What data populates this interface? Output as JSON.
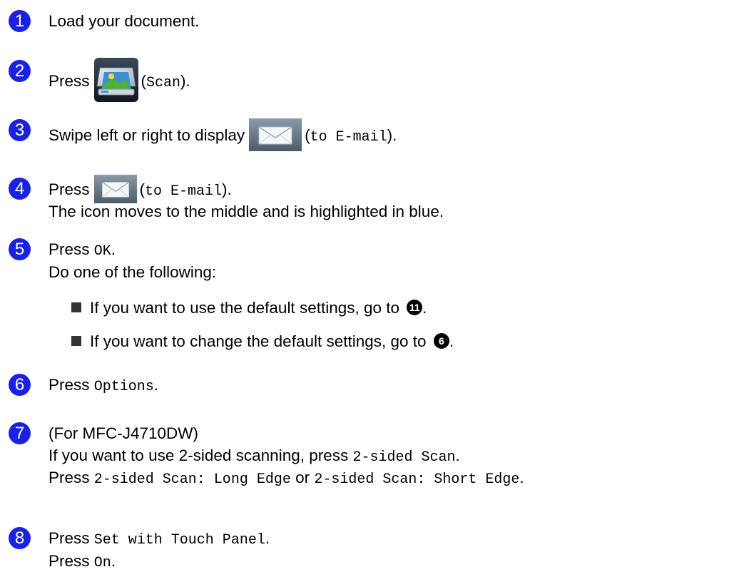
{
  "steps": [
    {
      "num": "1",
      "text": "Load your document."
    },
    {
      "num": "2",
      "pre": "Press",
      "paren_open": "(",
      "mono": "Scan",
      "paren_close": ").",
      "icon": "scan-icon"
    },
    {
      "num": "3",
      "pre": "Swipe left or right to display",
      "paren_open": "(",
      "mono": "to E-mail",
      "paren_close": ").",
      "icon": "mail-icon"
    },
    {
      "num": "4",
      "pre": "Press",
      "paren_open": "(",
      "mono": "to E-mail",
      "paren_close": ").",
      "icon": "mail-icon",
      "line2": "The icon moves to the middle and is highlighted in blue."
    },
    {
      "num": "5",
      "pre": "Press",
      "mono": "OK",
      "post": ".",
      "line2": "Do one of the following:",
      "bullets": [
        {
          "text": "If you want to use the default settings, go to",
          "ref": "11",
          "post": "."
        },
        {
          "text": "If you want to change the default settings, go to",
          "ref": "6",
          "post": "."
        }
      ]
    },
    {
      "num": "6",
      "pre": "Press",
      "mono": "Options",
      "post": "."
    },
    {
      "num": "7",
      "text": "(For MFC-J4710DW)",
      "line2_pre": "If you want to use 2-sided scanning, press",
      "line2_mono": "2-sided Scan",
      "line2_post": ".",
      "line3_pre": "Press",
      "line3_mono1": "2-sided Scan: Long Edge",
      "line3_or": "or",
      "line3_mono2": "2-sided Scan: Short Edge",
      "line3_post": "."
    },
    {
      "num": "8",
      "pre": "Press",
      "mono": "Set with Touch Panel",
      "post": ".",
      "line2_pre": "Press",
      "line2_mono": "On",
      "line2_post": "."
    }
  ],
  "colors": {
    "badge": "#1a22e0"
  }
}
